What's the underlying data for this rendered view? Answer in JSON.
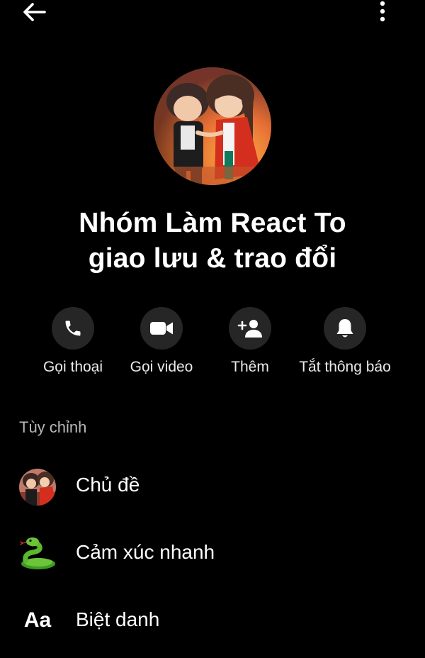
{
  "header": {
    "back_icon": "arrow-left-icon",
    "more_icon": "more-vertical-icon"
  },
  "group": {
    "avatar_description": "group-avatar-anime-characters",
    "title_line1": "Nhóm Làm React To",
    "title_line2": "giao lưu & trao đổi"
  },
  "actions": [
    {
      "label": "Gọi thoại",
      "icon": "phone-icon"
    },
    {
      "label": "Gọi video",
      "icon": "video-camera-icon"
    },
    {
      "label": "Thêm",
      "icon": "add-person-icon"
    },
    {
      "label": "Tắt thông báo",
      "icon": "bell-icon"
    }
  ],
  "customize": {
    "section_title": "Tùy chỉnh",
    "items": [
      {
        "label": "Chủ đề",
        "icon": "theme-thumbnail-icon"
      },
      {
        "label": "Cảm xúc nhanh",
        "icon": "snake-emoji-icon"
      },
      {
        "label": "Biệt danh",
        "icon": "aa-text-icon",
        "icon_text": "Aa"
      }
    ]
  },
  "colors": {
    "background": "#000000",
    "button_circle": "#262626",
    "text_primary": "#ffffff",
    "text_secondary": "#b8b8b8"
  }
}
